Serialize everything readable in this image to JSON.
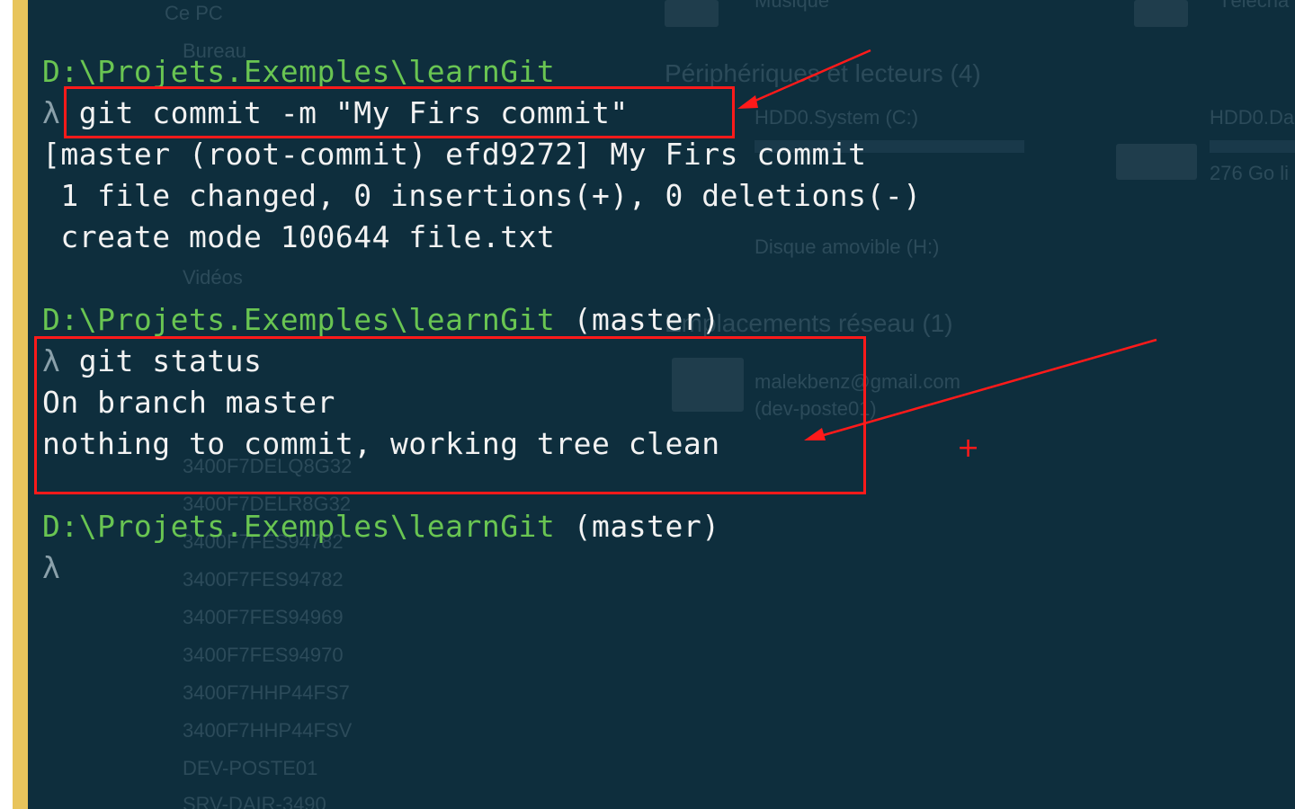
{
  "window": {
    "title": ""
  },
  "background_explorer": {
    "nav_items": [
      "Ce PC",
      "Bureau",
      "Vidéos",
      "3400F7DELQ8G32",
      "3400F7DELR8G32",
      "3400F7FES94782",
      "3400F7FES94969",
      "3400F7FES94970",
      "3400F7HHP44FS7",
      "3400F7HHP44FSV",
      "DEV-POSTE01",
      "SRV-DAIR-3490"
    ],
    "sections": [
      "Périphériques et lecteurs (4)",
      "Emplacements réseau (1)"
    ],
    "drives": [
      "HDD0.System (C:)",
      "HDD0.Da",
      "Disque amovible (H:)",
      "276 Go li",
      "Musique",
      "Télécha"
    ],
    "network": [
      "malekbenz@gmail.com",
      "(dev-poste01)"
    ]
  },
  "terminal": {
    "lines": [
      {
        "type": "path",
        "path": "D:\\Projets.Exemples\\learnGit",
        "branch": ""
      },
      {
        "type": "command",
        "prompt": "λ",
        "text": " git commit -m \"My Firs commit\""
      },
      {
        "type": "output",
        "text": "[master (root-commit) efd9272] My Firs commit"
      },
      {
        "type": "output",
        "text": " 1 file changed, 0 insertions(+), 0 deletions(-)"
      },
      {
        "type": "output",
        "text": " create mode 100644 file.txt"
      },
      {
        "type": "path",
        "path": "D:\\Projets.Exemples\\learnGit",
        "branch": " (master)"
      },
      {
        "type": "command",
        "prompt": "λ",
        "text": " git status"
      },
      {
        "type": "output",
        "text": "On branch master"
      },
      {
        "type": "output",
        "text": "nothing to commit, working tree clean"
      },
      {
        "type": "path",
        "path": "D:\\Projets.Exemples\\learnGit",
        "branch": " (master)"
      },
      {
        "type": "command",
        "prompt": "λ",
        "text": ""
      }
    ]
  },
  "annotations": {
    "color": "#ff1a1a",
    "cursor_marker": "+"
  }
}
